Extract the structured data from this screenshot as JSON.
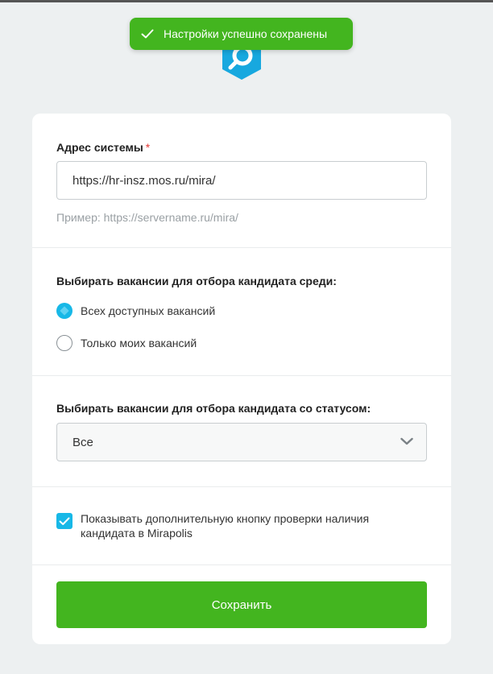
{
  "toast": {
    "message": "Настройки успешно сохранены"
  },
  "colors": {
    "accent_green": "#43b51f",
    "accent_blue": "#17b8e7",
    "required": "#e53935"
  },
  "icons": {
    "logo": "search-logo-icon",
    "toast": "check-icon",
    "select": "chevron-down-icon",
    "checkbox": "checkmark-icon"
  },
  "form": {
    "address": {
      "label": "Адрес системы",
      "required_mark": "*",
      "value": "https://hr-insz.mos.ru/mira/",
      "hint": "Пример: https://servername.ru/mira/"
    },
    "vacancy_scope": {
      "label": "Выбирать вакансии для отбора кандидата среди:",
      "options": [
        {
          "label": "Всех доступных вакансий",
          "checked": true
        },
        {
          "label": "Только моих вакансий",
          "checked": false
        }
      ]
    },
    "vacancy_status": {
      "label": "Выбирать вакансии для отбора кандидата со статусом:",
      "selected": "Все"
    },
    "extra_button": {
      "label": "Показывать дополнительную кнопку проверки наличия кандидата в Mirapolis",
      "checked": true
    },
    "save_label": "Сохранить"
  }
}
